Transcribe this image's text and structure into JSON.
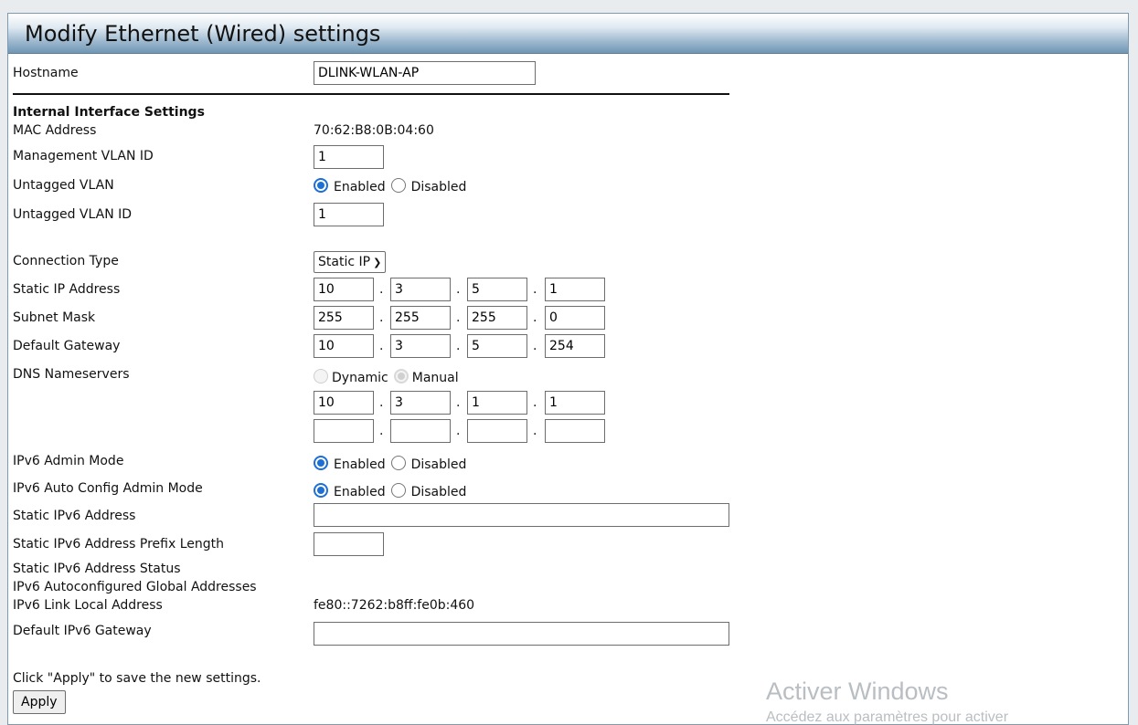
{
  "title": "Modify Ethernet (Wired) settings",
  "hostname": {
    "label": "Hostname",
    "value": "DLINK-WLAN-AP"
  },
  "internal": {
    "heading": "Internal Interface Settings",
    "mac_label": "MAC Address",
    "mac_value": "70:62:B8:0B:04:60",
    "mgmt_vlan_label": "Management VLAN ID",
    "mgmt_vlan_value": "1",
    "untagged_label": "Untagged VLAN",
    "untagged_vlan_id_label": "Untagged VLAN ID",
    "untagged_vlan_id_value": "1"
  },
  "radio_labels": {
    "enabled": "Enabled",
    "disabled": "Disabled",
    "dynamic": "Dynamic",
    "manual": "Manual"
  },
  "connection": {
    "type_label": "Connection Type",
    "type_value": "Static IP",
    "ip_label": "Static IP Address",
    "ip": [
      "10",
      "3",
      "5",
      "1"
    ],
    "mask_label": "Subnet Mask",
    "mask": [
      "255",
      "255",
      "255",
      "0"
    ],
    "gateway_label": "Default Gateway",
    "gateway": [
      "10",
      "3",
      "5",
      "254"
    ],
    "dns_label": "DNS Nameservers",
    "dns1": [
      "10",
      "3",
      "1",
      "1"
    ],
    "dns2": [
      "",
      "",
      "",
      ""
    ]
  },
  "ipv6": {
    "admin_label": "IPv6 Admin Mode",
    "auto_label": "IPv6 Auto Config Admin Mode",
    "static_addr_label": "Static IPv6 Address",
    "static_addr_value": "",
    "prefix_label": "Static IPv6 Address Prefix Length",
    "prefix_value": "",
    "status_label": "Static IPv6 Address Status",
    "auto_global_label": "IPv6 Autoconfigured Global Addresses",
    "link_local_label": "IPv6 Link Local Address",
    "link_local_value": "fe80::7262:b8ff:fe0b:460",
    "gateway_label": "Default IPv6 Gateway",
    "gateway_value": ""
  },
  "footer": {
    "hint": "Click \"Apply\" to save the new settings.",
    "apply_label": "Apply"
  },
  "watermark": {
    "line1": "Activer Windows",
    "line2": "Accédez aux paramètres pour activer"
  }
}
